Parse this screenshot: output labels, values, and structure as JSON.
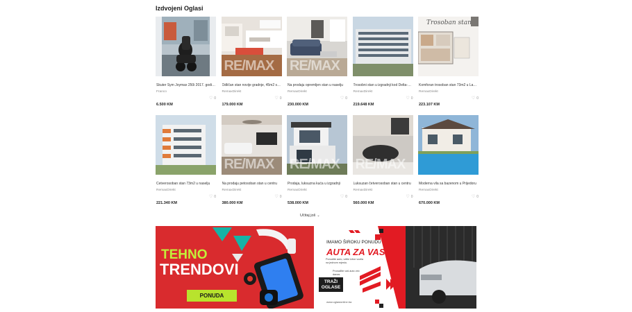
{
  "section_title": "Izdvojeni Oglasi",
  "load_more": "Učitaj još",
  "listings_row1": [
    {
      "title": "Skuter Sym Joymax 250i 2017. godište",
      "seller": "Franco",
      "likes": "0",
      "price": "6.500 KM",
      "watermark": ""
    },
    {
      "title": "Odličan stan novije gradnje, 45m2 sa garažom",
      "seller": "RemaxDirekt",
      "likes": "0",
      "price": "179.000 KM",
      "watermark": "RE/MAX"
    },
    {
      "title": "Na prodaju opremljen stan u naselju",
      "seller": "RemaxDirekt",
      "likes": "0",
      "price": "230.000 KM",
      "watermark": "RE/MAX"
    },
    {
      "title": "Trosobni stan u izgradnji kod Delta-56,32m2",
      "seller": "RemaxDirekt",
      "likes": "0",
      "price": "219.648 KM",
      "watermark": ""
    },
    {
      "title": "Komforan trosoban stan 73m2 u Lamelama",
      "seller": "RemaxDirekt",
      "likes": "0",
      "price": "223.107 KM",
      "watermark": "",
      "overlay": "Trosoban stan"
    }
  ],
  "listings_row2": [
    {
      "title": "Četverosoban stan 73m2 u naselju",
      "seller": "RemaxDirekt",
      "likes": "0",
      "price": "221.340 KM",
      "watermark": ""
    },
    {
      "title": "Na prodaju petosoban stan u centru",
      "seller": "RemaxDirekt",
      "likes": "0",
      "price": "380.000 KM",
      "watermark": "RE/MAX"
    },
    {
      "title": "Prodaja, luksuzna kuća u izgradnji",
      "seller": "RemaxDirekt",
      "likes": "0",
      "price": "538.000 KM",
      "watermark": "RE/MAX"
    },
    {
      "title": "Luksuzan četverosoban stan u centru",
      "seller": "RemaxDirekt",
      "likes": "0",
      "price": "560.000 KM",
      "watermark": "RE/MAX"
    },
    {
      "title": "Moderna vila sa bazenom u Prijedoru",
      "seller": "RemaxDirekt",
      "likes": "0",
      "price": "670.000 KM",
      "watermark": ""
    }
  ],
  "banner_left": {
    "line1": "TEHNO",
    "line2": "TRENDOVI",
    "button": "PONUDA"
  },
  "banner_right": {
    "line1": "IMAMO ŠIROKU PONUDU",
    "line2": "AUTA ZA VAS!",
    "copy1": "Ponudite auto, veliki izbor vozila na jednom mjestu.",
    "copy2": "Pronađite vaš auto već danas",
    "button": "TRAŽI OGLASE",
    "url": "www.oglasionline.ba"
  },
  "colors": {
    "banner_left_bg": "#d92b2e",
    "banner_left_accent": "#b8e32d",
    "banner_right_accent": "#e21b23"
  }
}
